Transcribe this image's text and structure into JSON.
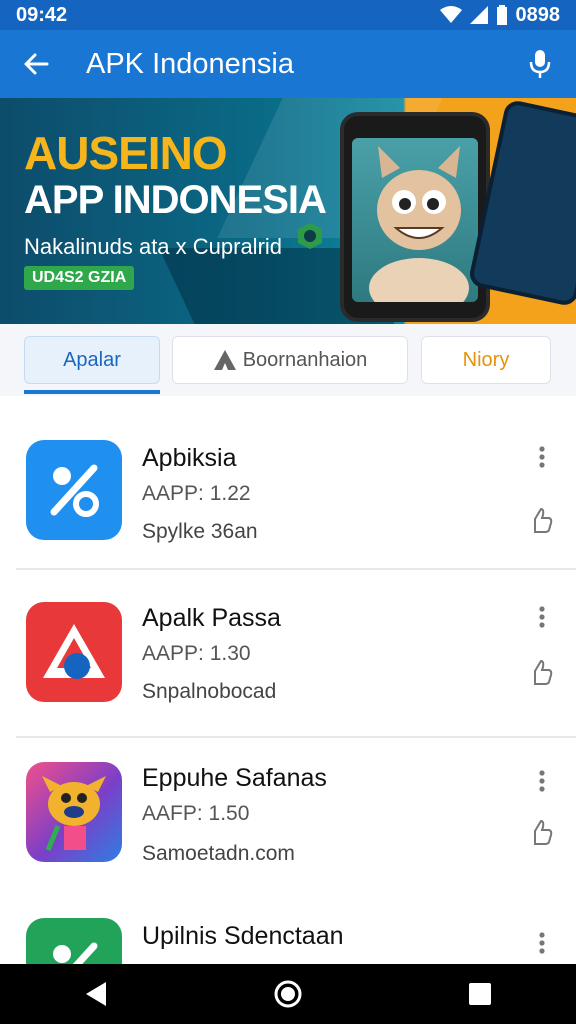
{
  "status_bar": {
    "time": "09:42",
    "battery": "0898"
  },
  "app_bar": {
    "title": "APK Indonensia",
    "back_icon": "arrow-left-icon",
    "mic_icon": "mic-icon"
  },
  "banner": {
    "headline1": "AUSEINO",
    "headline2": "APP INDONESIA",
    "subtitle": "Nakalinuds ata x Cupralrid",
    "tag": "UD4S2 GZIA",
    "colors": {
      "headline1": "#f7b51c",
      "tag_bg": "#2ea84a",
      "accent": "#f4a11b"
    }
  },
  "tabs": [
    {
      "label": "Apalar",
      "active": true
    },
    {
      "label": "Boornanhaion",
      "active": false,
      "icon": "a-logo-icon"
    },
    {
      "label": "Niory",
      "active": false
    }
  ],
  "apps": [
    {
      "name": "Apbiksia",
      "meta": "AAPP: 1.22",
      "dev": "Spylke 36an",
      "icon": "percent-icon",
      "color": "#1f8ff0"
    },
    {
      "name": "Apalk Passa",
      "meta": "AAPP: 1.30",
      "dev": "Snpalnobocad",
      "icon": "triangle-logo-icon",
      "color": "#e8383a"
    },
    {
      "name": "Eppuhe Safanas",
      "meta": "AAFP: 1.50",
      "dev": "Samoetadn.com",
      "icon": "cartoon-creature-icon",
      "color": "#7b3fc8"
    },
    {
      "name": "Upilnis Sdenctaan",
      "meta": "",
      "dev": "",
      "icon": "percent-icon",
      "color": "#21a35a"
    }
  ],
  "nav": {
    "back": "back-triangle-icon",
    "home": "home-circle-icon",
    "recent": "recents-square-icon"
  }
}
